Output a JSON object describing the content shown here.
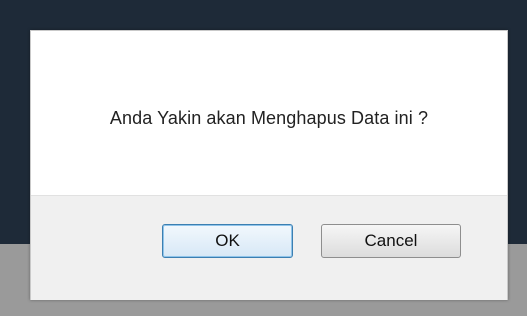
{
  "dialog": {
    "message": "Anda Yakin akan Menghapus Data ini ?",
    "ok_label": "OK",
    "cancel_label": "Cancel"
  },
  "colors": {
    "backdrop_dark": "#1e2a38",
    "backdrop_grey": "#9a9a9a",
    "dialog_body": "#ffffff",
    "dialog_footer": "#f0f0f0",
    "ok_focus_border": "#3c7fb1"
  }
}
